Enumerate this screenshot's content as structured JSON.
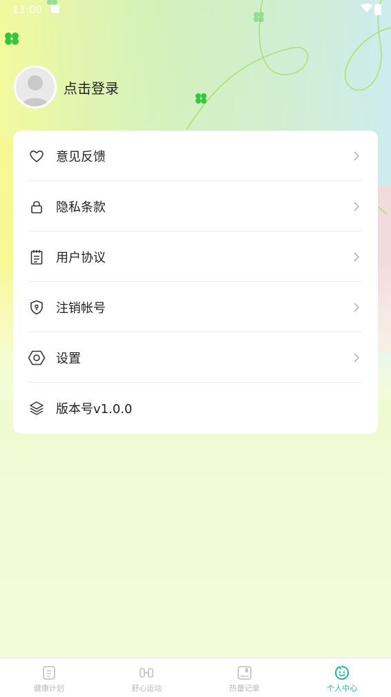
{
  "status_bar": {
    "time": "11:00"
  },
  "profile": {
    "login_label": "点击登录"
  },
  "menu": {
    "items": [
      {
        "label": "意见反馈",
        "icon": "heart-icon"
      },
      {
        "label": "隐私条款",
        "icon": "lock-icon"
      },
      {
        "label": "用户协议",
        "icon": "notepad-icon"
      },
      {
        "label": "注销帐号",
        "icon": "shield-icon"
      },
      {
        "label": "设置",
        "icon": "hexagon-icon"
      },
      {
        "label": "版本号v1.0.0",
        "icon": "layers-icon"
      }
    ]
  },
  "tabbar": {
    "tabs": [
      {
        "label": "健康计划",
        "icon": "plan-icon"
      },
      {
        "label": "舒心运动",
        "icon": "sport-icon"
      },
      {
        "label": "热量记录",
        "icon": "record-icon"
      },
      {
        "label": "个人中心",
        "icon": "smiley-icon"
      }
    ],
    "active_color": "#1bb6b0",
    "inactive_color": "#b8b8b8"
  }
}
